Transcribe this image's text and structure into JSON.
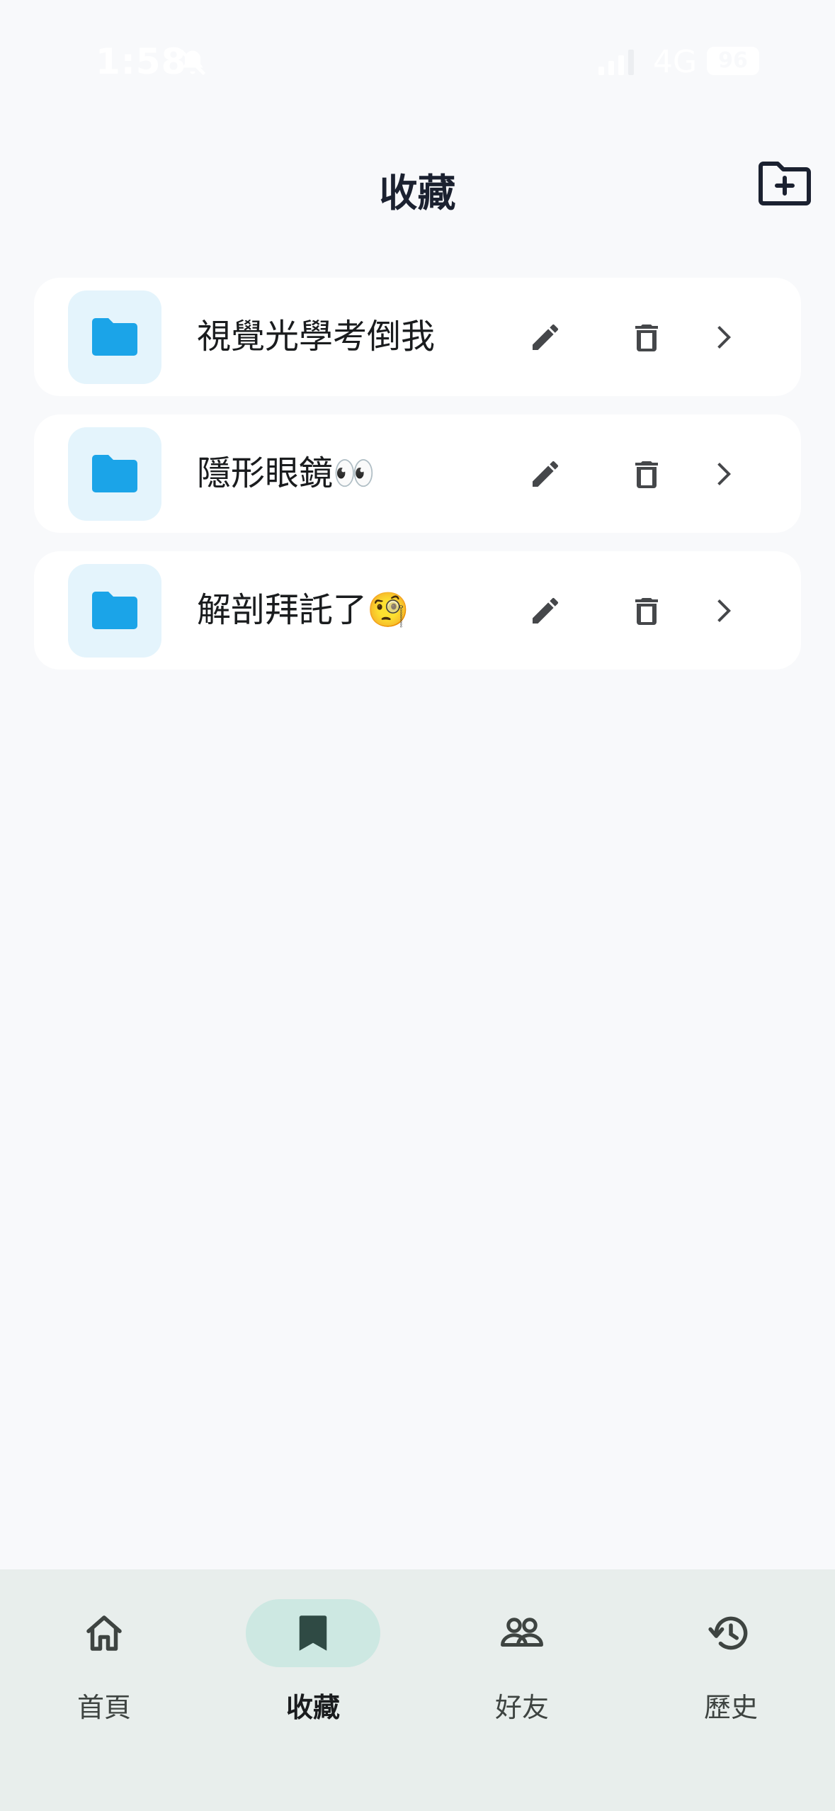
{
  "status_bar": {
    "time": "1:58",
    "network": "4G",
    "battery": "96"
  },
  "header": {
    "title": "收藏",
    "add_folder_icon": "folder-plus-icon"
  },
  "folders": [
    {
      "name": "視覺光學考倒我"
    },
    {
      "name": "隱形眼鏡👀"
    },
    {
      "name": "解剖拜託了🧐"
    }
  ],
  "nav": {
    "items": [
      {
        "label": "首頁",
        "icon": "home-icon"
      },
      {
        "label": "收藏",
        "icon": "bookmark-icon",
        "active": true
      },
      {
        "label": "好友",
        "icon": "friends-icon"
      },
      {
        "label": "歷史",
        "icon": "history-icon"
      }
    ]
  },
  "colors": {
    "accent": "#1ba4e8",
    "nav_active_bg": "#cde8e2",
    "background": "#f8f9fb"
  }
}
